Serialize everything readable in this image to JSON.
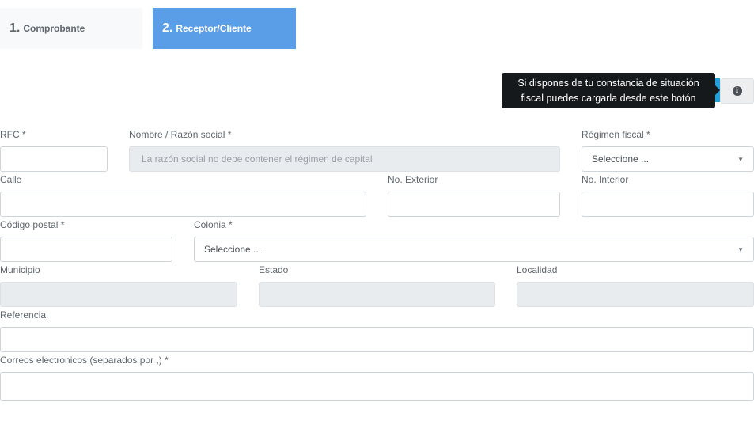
{
  "steps": [
    {
      "number": "1.",
      "label": "Comprobante"
    },
    {
      "number": "2.",
      "label": "Receptor/Cliente"
    }
  ],
  "tooltip": {
    "line1": "Si dispones de tu constancia de situación",
    "line2": "fiscal puedes cargarla desde este botón"
  },
  "info_button": {
    "icon": "info-icon",
    "glyph": "i"
  },
  "colors": {
    "active_step": "#5b9ee8",
    "tooltip_bg": "#16191c",
    "accent": "#1fa0d8",
    "disabled_field": "#e9ecef"
  },
  "form": {
    "rfc": {
      "label": "RFC *",
      "value": ""
    },
    "nombre": {
      "label": "Nombre / Razón social *",
      "placeholder": "La razón social no debe  contener el régimen de capital"
    },
    "regimen": {
      "label": "Régimen fiscal *",
      "selected": "Seleccione ..."
    },
    "calle": {
      "label": "Calle",
      "value": ""
    },
    "no_exterior": {
      "label": "No. Exterior",
      "value": ""
    },
    "no_interior": {
      "label": "No. Interior",
      "value": ""
    },
    "codigo_postal": {
      "label": "Código postal *",
      "value": ""
    },
    "colonia": {
      "label": "Colonia *",
      "selected": "Seleccione ..."
    },
    "municipio": {
      "label": "Municipio",
      "value": ""
    },
    "estado": {
      "label": "Estado",
      "value": ""
    },
    "localidad": {
      "label": "Localidad",
      "value": ""
    },
    "referencia": {
      "label": "Referencia",
      "value": ""
    },
    "correos": {
      "label": "Correos electronicos (separados por ,) *",
      "value": ""
    }
  }
}
